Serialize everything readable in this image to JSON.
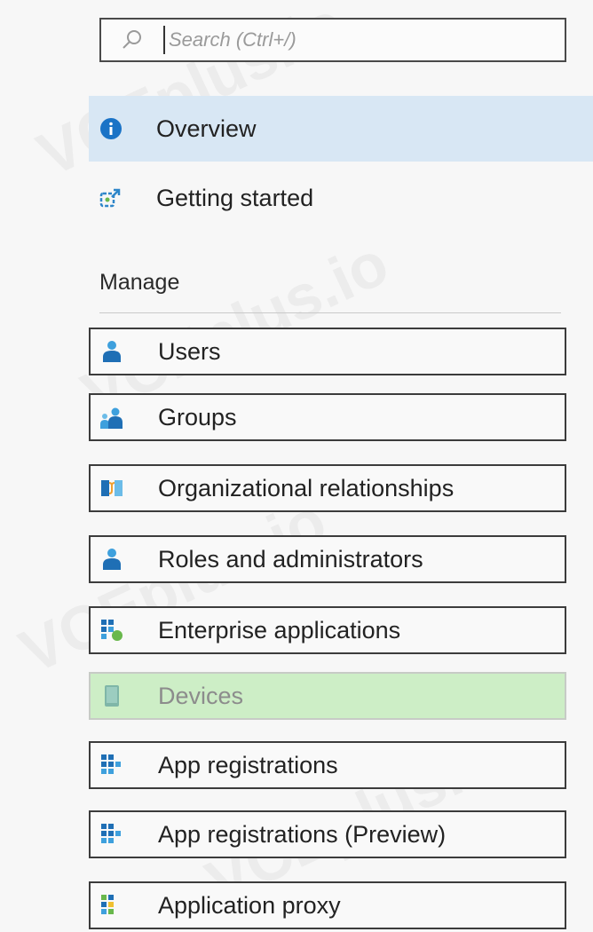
{
  "search": {
    "placeholder": "Search (Ctrl+/)"
  },
  "top_nav": [
    {
      "label": "Overview",
      "icon": "info-icon",
      "active": true
    },
    {
      "label": "Getting started",
      "icon": "getting-started-icon"
    }
  ],
  "manage": {
    "title": "Manage",
    "items": [
      {
        "label": "Users",
        "icon": "user-icon"
      },
      {
        "label": "Groups",
        "icon": "groups-icon"
      },
      {
        "label": "Organizational relationships",
        "icon": "org-relationships-icon"
      },
      {
        "label": "Roles and administrators",
        "icon": "roles-icon"
      },
      {
        "label": "Enterprise applications",
        "icon": "enterprise-apps-icon"
      },
      {
        "label": "Devices",
        "icon": "device-icon",
        "selected": true
      },
      {
        "label": "App registrations",
        "icon": "app-registrations-icon"
      },
      {
        "label": "App registrations (Preview)",
        "icon": "app-registrations-preview-icon"
      },
      {
        "label": "Application proxy",
        "icon": "application-proxy-icon"
      }
    ]
  },
  "colors": {
    "active_bg": "#d8e7f4",
    "selected_bg": "#cdeec6",
    "accent_blue": "#1a73c6"
  }
}
